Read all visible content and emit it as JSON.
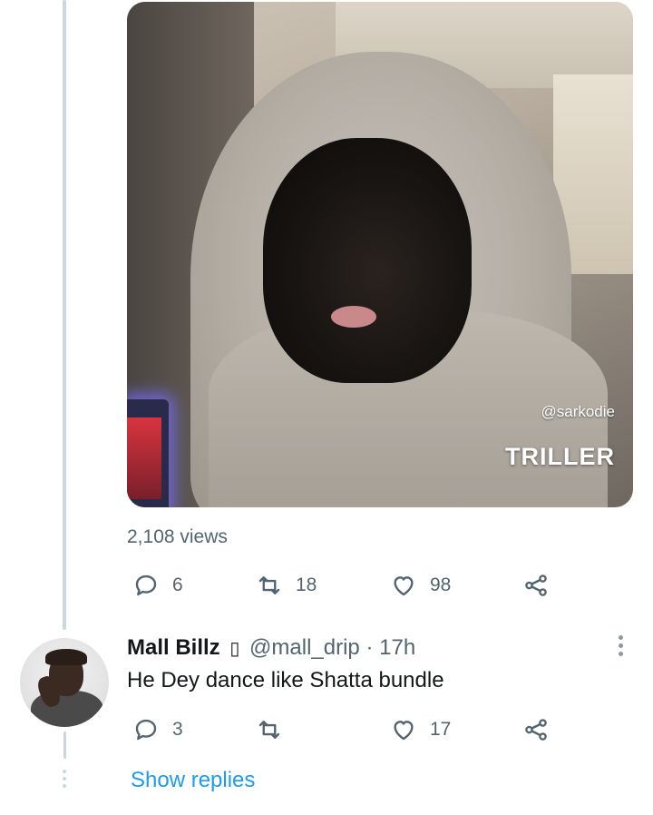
{
  "media": {
    "watermark_handle": "@sarkodie",
    "watermark_brand": "TRILLER"
  },
  "tweet": {
    "views": "2,108 views",
    "replies": "6",
    "retweets": "18",
    "likes": "98"
  },
  "reply": {
    "name": "Mall Billz",
    "verified_glyph": "▯",
    "handle": "@mall_drip",
    "separator": "·",
    "time": "17h",
    "text": "He Dey dance like Shatta bundle",
    "replies": "3",
    "retweets": "",
    "likes": "17",
    "show_replies": "Show replies"
  },
  "icons": {
    "reply": "reply-icon",
    "retweet": "retweet-icon",
    "like": "heart-icon",
    "share": "share-icon",
    "more": "more-vertical-icon"
  }
}
